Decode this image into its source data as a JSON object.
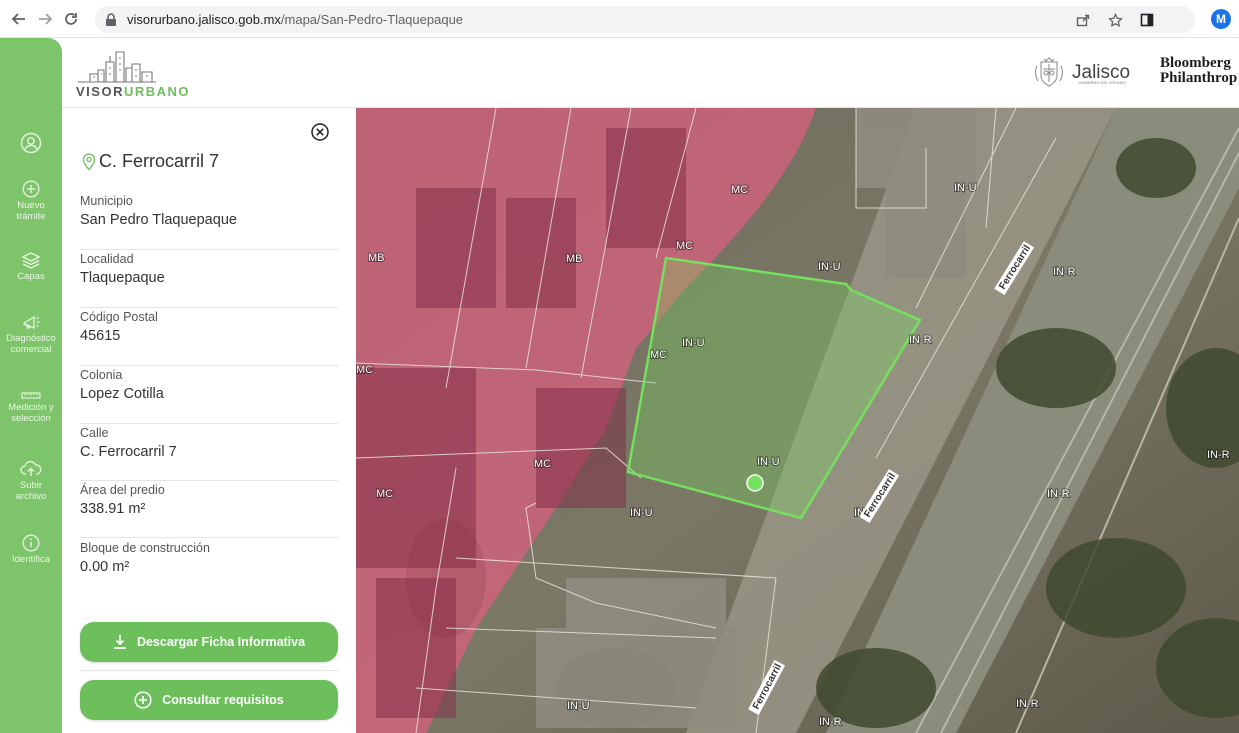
{
  "browser": {
    "url_domain": "visorurbano.jalisco.gob.mx",
    "url_path": "/mapa/San-Pedro-Tlaquepaque",
    "profile_initial": "M"
  },
  "rail": {
    "items": [
      {
        "label": "",
        "icon": "user-icon"
      },
      {
        "label": "Nuevo trámite",
        "icon": "plus-circle-icon"
      },
      {
        "label": "Capas",
        "icon": "layers-icon"
      },
      {
        "label": "Diagnóstico comercial",
        "icon": "megaphone-icon"
      },
      {
        "label": "Medición y selección",
        "icon": "ruler-icon"
      },
      {
        "label": "Subir archivo",
        "icon": "cloud-upload-icon"
      },
      {
        "label": "Identifica",
        "icon": "info-icon"
      }
    ]
  },
  "header": {
    "logo_text_a": "VISOR",
    "logo_text_b": "URBANO",
    "partner1": "Jalisco",
    "partner1_sub": "GOBIERNO DEL ESTADO",
    "partner2_line1": "Bloomberg",
    "partner2_line2": "Philanthrop"
  },
  "panel": {
    "title": "C. Ferrocarril 7",
    "fields": [
      {
        "label": "Municipio",
        "value": "San Pedro Tlaquepaque"
      },
      {
        "label": "Localidad",
        "value": "Tlaquepaque"
      },
      {
        "label": "Código Postal",
        "value": "45615"
      },
      {
        "label": "Colonia",
        "value": "Lopez Cotilla"
      },
      {
        "label": "Calle",
        "value": "C. Ferrocarril 7"
      },
      {
        "label": "Área del predio",
        "value": "338.91 m²"
      },
      {
        "label": "Bloque de construcción",
        "value": "0.00 m²"
      }
    ],
    "download_button": "Descargar Ficha Informativa",
    "requirements_button": "Consultar requisitos"
  },
  "map": {
    "zone_labels": [
      "MC",
      "MB",
      "MB",
      "MC",
      "IN-U",
      "IN-U",
      "IN-R",
      "IN-U",
      "MC",
      "MC",
      "IN-U",
      "MC",
      "IN-U",
      "IN-R",
      "IN-R",
      "IN-R",
      "IN",
      "IN-U",
      "IN-R",
      "IN-R"
    ],
    "street_labels": [
      "Ferrocarril",
      "Ferrocarril",
      "Ferrocarril"
    ],
    "colors": {
      "pink_zone": "#d9607f",
      "selection": "#74e05e"
    }
  }
}
